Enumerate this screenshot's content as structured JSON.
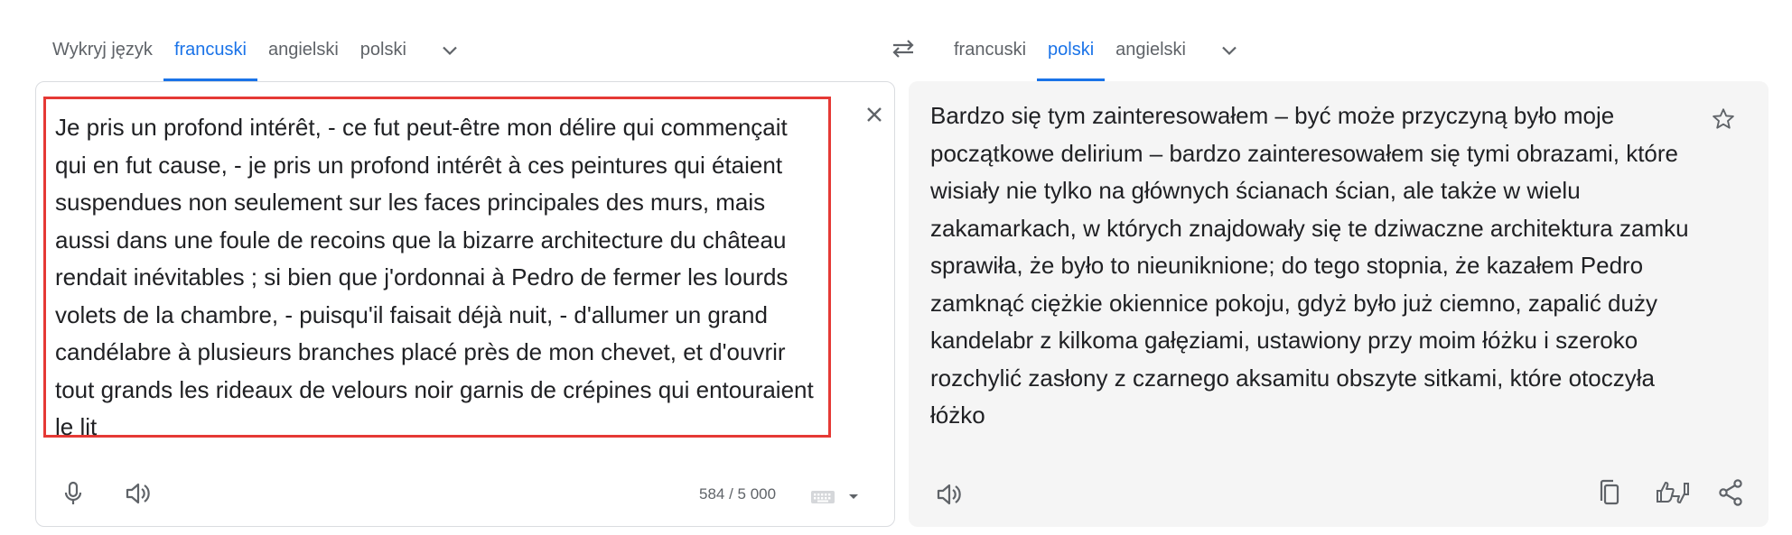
{
  "source_langs": {
    "tabs": [
      "Wykryj język",
      "francuski",
      "angielski",
      "polski"
    ],
    "active": "francuski"
  },
  "target_langs": {
    "tabs": [
      "francuski",
      "polski",
      "angielski"
    ],
    "active": "polski"
  },
  "source": {
    "text": "Je pris un profond intérêt, - ce fut peut-être mon délire qui commençait qui en fut cause, - je pris un profond intérêt à ces peintures qui étaient suspendues non seulement sur les faces principales des murs, mais aussi dans une foule de recoins que la bizarre architecture du château rendait inévitables ; si bien que j'ordonnai à Pedro de fermer les lourds volets de la chambre, - puisqu'il faisait déjà nuit, - d'allumer un grand candélabre à plusieurs branches placé près de mon chevet, et d'ouvrir tout grands les rideaux de velours noir garnis de crépines qui entouraient le lit",
    "char_count": "584 / 5 000"
  },
  "target": {
    "text": "Bardzo się tym zainteresowałem – być może przyczyną było moje początkowe delirium – bardzo zainteresowałem się tymi obrazami, które wisiały nie tylko na głównych ścianach ścian, ale także w wielu zakamarkach, w których znajdowały się te dziwaczne architektura zamku sprawiła, że było to nieuniknione; do tego stopnia, że kazałem Pedro zamknąć ciężkie okiennice pokoju, gdyż było już ciemno, zapalić duży kandelabr z kilkoma gałęziami, ustawiony przy moim łóżku i szeroko rozchylić zasłony z czarnego aksamitu obszyte sitkami, które otoczyła łóżko"
  },
  "colors": {
    "accent": "#1a73e8",
    "highlight_border": "#e53935",
    "icon": "#5f6368",
    "target_bg": "#f5f5f5"
  },
  "icons": [
    "chevron-down-icon",
    "swap-languages-icon",
    "close-icon",
    "microphone-icon",
    "speaker-icon",
    "keyboard-icon",
    "dropdown-arrow-icon",
    "star-icon",
    "copy-icon",
    "rate-translation-icon",
    "share-icon"
  ]
}
